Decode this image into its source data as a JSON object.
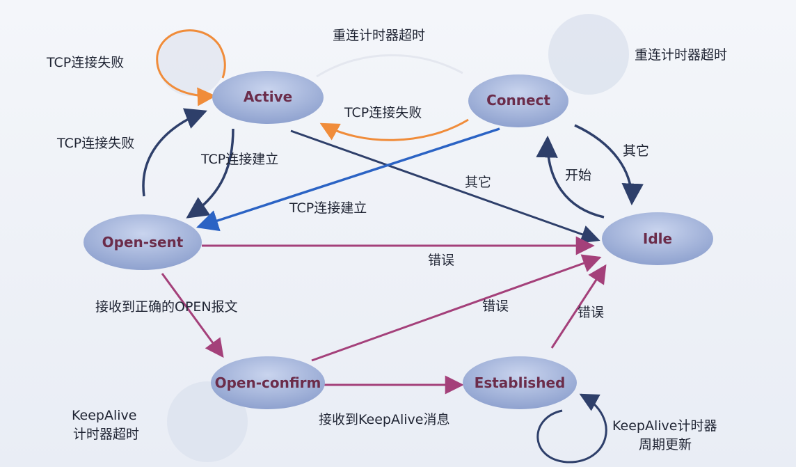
{
  "states": {
    "active": "Active",
    "connect": "Connect",
    "open_sent": "Open-sent",
    "idle": "Idle",
    "open_confirm": "Open-confirm",
    "established": "Established"
  },
  "labels": {
    "active_self_loop": "TCP连接失败",
    "connect_to_active_timer": "重连计时器超时",
    "connect_self_loop": "重连计时器超时",
    "connect_to_active_fail": "TCP连接失败",
    "opensent_to_active_fail": "TCP连接失败",
    "active_to_opensent": "TCP连接建立",
    "active_to_idle_other": "其它",
    "connect_to_opensent": "TCP连接建立",
    "connect_to_idle_other": "其它",
    "idle_to_connect_start": "开始",
    "opensent_to_idle_error": "错误",
    "opensent_to_openconfirm": "接收到正确的OPEN报文",
    "openconfirm_to_idle_error": "错误",
    "established_to_idle_error": "错误",
    "openconfirm_to_established": "接收到KeepAlive消息",
    "openconfirm_self_loop_line1": "KeepAlive",
    "openconfirm_self_loop_line2": "计时器超时",
    "established_self_loop_line1": "KeepAlive计时器",
    "established_self_loop_line2": "周期更新"
  },
  "colors": {
    "state_fill": "#a9b8db",
    "state_text": "#6b2c4a",
    "edge_orange": "#f08c3a",
    "edge_navy": "#2e3f6a",
    "edge_blue": "#2b63c4",
    "edge_magenta": "#a4407a",
    "loop_fill": "#d9dfec"
  }
}
